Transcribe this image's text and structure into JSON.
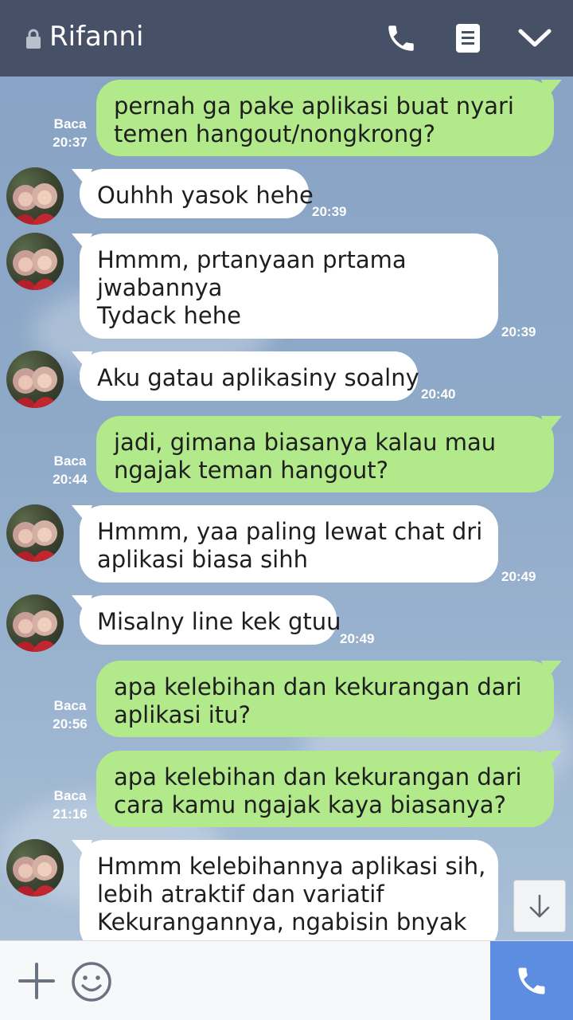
{
  "header": {
    "title": "Rifanni",
    "icons": [
      "lock-icon",
      "phone-icon",
      "note-icon",
      "chevron-down-icon"
    ]
  },
  "messages": [
    {
      "from": "me",
      "lines": [
        "pernah ga pake aplikasi buat nyari",
        "temen hangout/nongkrong?"
      ],
      "read": "Baca",
      "time": "20:37"
    },
    {
      "from": "them",
      "lines": [
        "Ouhhh yasok hehe"
      ],
      "time": "20:39"
    },
    {
      "from": "them",
      "lines": [
        "Hmmm, prtanyaan prtama",
        "jwabannya",
        "Tydack hehe"
      ],
      "time": "20:39"
    },
    {
      "from": "them",
      "lines": [
        "Aku gatau aplikasiny soalny"
      ],
      "time": "20:40"
    },
    {
      "from": "me",
      "lines": [
        "jadi, gimana biasanya kalau mau",
        "ngajak teman hangout?"
      ],
      "read": "Baca",
      "time": "20:44"
    },
    {
      "from": "them",
      "lines": [
        "Hmmm, yaa paling lewat chat dri",
        "aplikasi biasa sihh"
      ],
      "time": "20:49"
    },
    {
      "from": "them",
      "lines": [
        "Misalny line kek gtuu"
      ],
      "time": "20:49"
    },
    {
      "from": "me",
      "lines": [
        "apa kelebihan dan kekurangan dari",
        "aplikasi itu?"
      ],
      "read": "Baca",
      "time": "20:56"
    },
    {
      "from": "me",
      "lines": [
        "apa kelebihan dan kekurangan dari",
        "cara kamu ngajak kaya biasanya?"
      ],
      "read": "Baca",
      "time": "21:16"
    },
    {
      "from": "them",
      "lines": [
        "Hmmm kelebihannya aplikasi sih,",
        "lebih atraktif dan variatif",
        "Kekurangannya, ngabisin bnyak"
      ]
    }
  ],
  "footer": {
    "icons": [
      "plus-icon",
      "emoji-icon",
      "phone-icon"
    ]
  },
  "colors": {
    "header": "#465066",
    "my_bubble": "#b2ea8b",
    "their_bubble": "#ffffff",
    "call_button": "#5c8de0"
  }
}
